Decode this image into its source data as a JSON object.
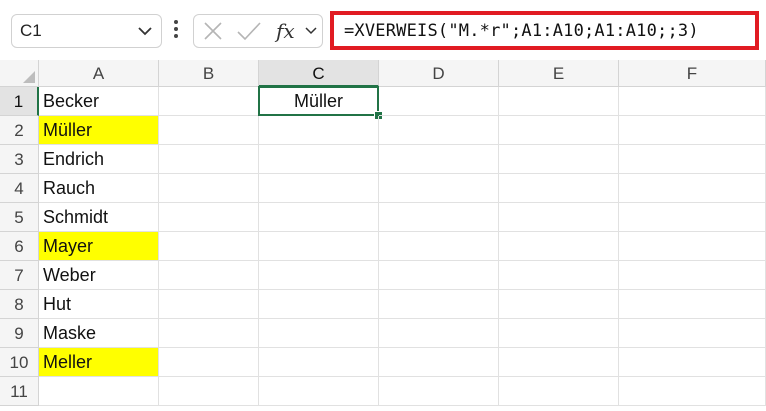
{
  "name_box": {
    "value": "C1"
  },
  "formula_bar": {
    "cancel_icon": "close-icon",
    "enter_icon": "check-icon",
    "fx_label": "fx",
    "formula": "=XVERWEIS(\"M.*r\";A1:A10;A1:A10;;3)"
  },
  "columns": [
    "A",
    "B",
    "C",
    "D",
    "E",
    "F"
  ],
  "selected_column": "C",
  "rows": [
    "1",
    "2",
    "3",
    "4",
    "5",
    "6",
    "7",
    "8",
    "9",
    "10",
    "11"
  ],
  "selected_row": "1",
  "cells": {
    "A1": "Becker",
    "A2": "Müller",
    "A3": "Endrich",
    "A4": "Rauch",
    "A5": "Schmidt",
    "A6": "Mayer",
    "A7": "Weber",
    "A8": "Hut",
    "A9": "Maske",
    "A10": "Meller",
    "C1": "Müller"
  },
  "highlighted_cells": [
    "A2",
    "A6",
    "A10"
  ],
  "highlight_color": "#ffff00",
  "active_cell": "C1",
  "accent_color": "#217346",
  "formula_outline_color": "#e11b22"
}
